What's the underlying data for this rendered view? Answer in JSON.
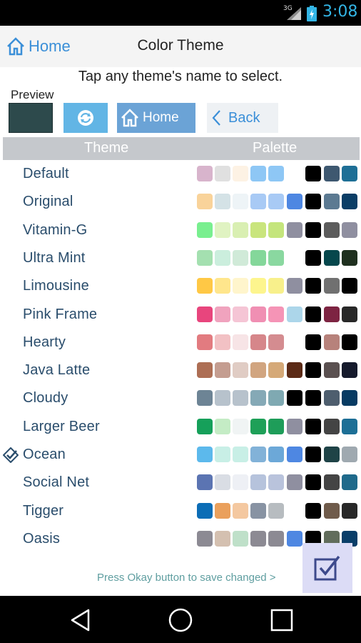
{
  "status_bar": {
    "network": "3G",
    "time": "3:08"
  },
  "action_bar": {
    "home_label": "Home",
    "title": "Color Theme"
  },
  "instruction": "Tap any theme's name to select.",
  "preview": {
    "label": "Preview",
    "swatch_color": "#2d4a4c",
    "home_button_label": "Home",
    "back_button_label": "Back"
  },
  "table_header": {
    "theme": "Theme",
    "palette": "Palette"
  },
  "themes": [
    {
      "name": "Default",
      "selected": false,
      "palette": [
        "#d8b4cc",
        "#e0e0e0",
        "#fdf2e4",
        "#8ec7f5",
        "#8ec7f5",
        "",
        "#000000",
        "#3e5870",
        "#1e6f96"
      ]
    },
    {
      "name": "Original",
      "selected": false,
      "palette": [
        "#f9d39a",
        "#d4e2e6",
        "#eef4f7",
        "#a8caf5",
        "#a8caf5",
        "#4e87e2",
        "#000000",
        "#5c7a92",
        "#0b3e66"
      ]
    },
    {
      "name": "Vitamin-G",
      "selected": false,
      "palette": [
        "#79ef8f",
        "#e0f3c2",
        "#d9efb2",
        "#c9e57d",
        "#c4e57c",
        "#8f8fa0",
        "#000000",
        "#5c5c5c",
        "#8f8fa0"
      ]
    },
    {
      "name": "Ultra Mint",
      "selected": false,
      "palette": [
        "#a4e0b0",
        "#cbeedd",
        "#d0ead8",
        "#84d79a",
        "#8ad8a0",
        "",
        "#000000",
        "#06474c",
        "#1f301f"
      ]
    },
    {
      "name": "Limousine",
      "selected": false,
      "palette": [
        "#ffc845",
        "#ffe68c",
        "#fff5cc",
        "#fdf58e",
        "#f8f08b",
        "#8f8fa0",
        "#000000",
        "#707070",
        "#000000"
      ]
    },
    {
      "name": "Pink Frame",
      "selected": false,
      "palette": [
        "#e8457d",
        "#f0a3be",
        "#f5c5d5",
        "#f08fb3",
        "#f594b6",
        "#acd6ea",
        "#000000",
        "#7d2442",
        "#282828"
      ]
    },
    {
      "name": "Hearty",
      "selected": false,
      "palette": [
        "#e27b80",
        "#f2c1c4",
        "#f7e4e6",
        "#d6868a",
        "#d48c90",
        "",
        "#000000",
        "#b7827b",
        "#000000"
      ]
    },
    {
      "name": "Java Latte",
      "selected": false,
      "palette": [
        "#ad6e54",
        "#c49d90",
        "#e0ccc4",
        "#d1a580",
        "#d5a978",
        "#5b2a16",
        "#000000",
        "#5a5050",
        "#151a2c"
      ]
    },
    {
      "name": "Cloudy",
      "selected": false,
      "palette": [
        "#6d8495",
        "#b7c2cc",
        "#b7c2cc",
        "#85a9b6",
        "#7fa9b2",
        "#000000",
        "#000000",
        "#4e5e6e",
        "#083b63"
      ]
    },
    {
      "name": "Larger Beer",
      "selected": false,
      "palette": [
        "#16a05a",
        "#c4ecc5",
        "#f0f4f4",
        "#1ea058",
        "#1e9d59",
        "#8f8fa0",
        "#000000",
        "#444444",
        "#1d6f96"
      ]
    },
    {
      "name": "Ocean",
      "selected": true,
      "palette": [
        "#5cb9ec",
        "#c8efe6",
        "#c8efe6",
        "#82b2d8",
        "#6ca8d8",
        "#4e87e2",
        "#000000",
        "#1f4347",
        "#9fa9b0"
      ]
    },
    {
      "name": "Social Net",
      "selected": false,
      "palette": [
        "#5b74b2",
        "#d9dde4",
        "#eef0f5",
        "#b6c3dc",
        "#b9c3dc",
        "#8f8fa0",
        "#000000",
        "#444444",
        "#1f6a8b"
      ]
    },
    {
      "name": "Tigger",
      "selected": false,
      "palette": [
        "#0b6db6",
        "#eaa05c",
        "#f4c8a0",
        "#8893a3",
        "#b7bcc0",
        "",
        "#000000",
        "#6f5b4b",
        "#282828"
      ]
    },
    {
      "name": "Oasis",
      "selected": false,
      "palette": [
        "#8c8a93",
        "#d4c0b0",
        "#bfe0c9",
        "#8c8a93",
        "#8c8a93",
        "#4e87e2",
        "#000000",
        "#626d5c",
        "#093e69"
      ]
    }
  ],
  "footer_text": "Press Okay button to save changed >"
}
